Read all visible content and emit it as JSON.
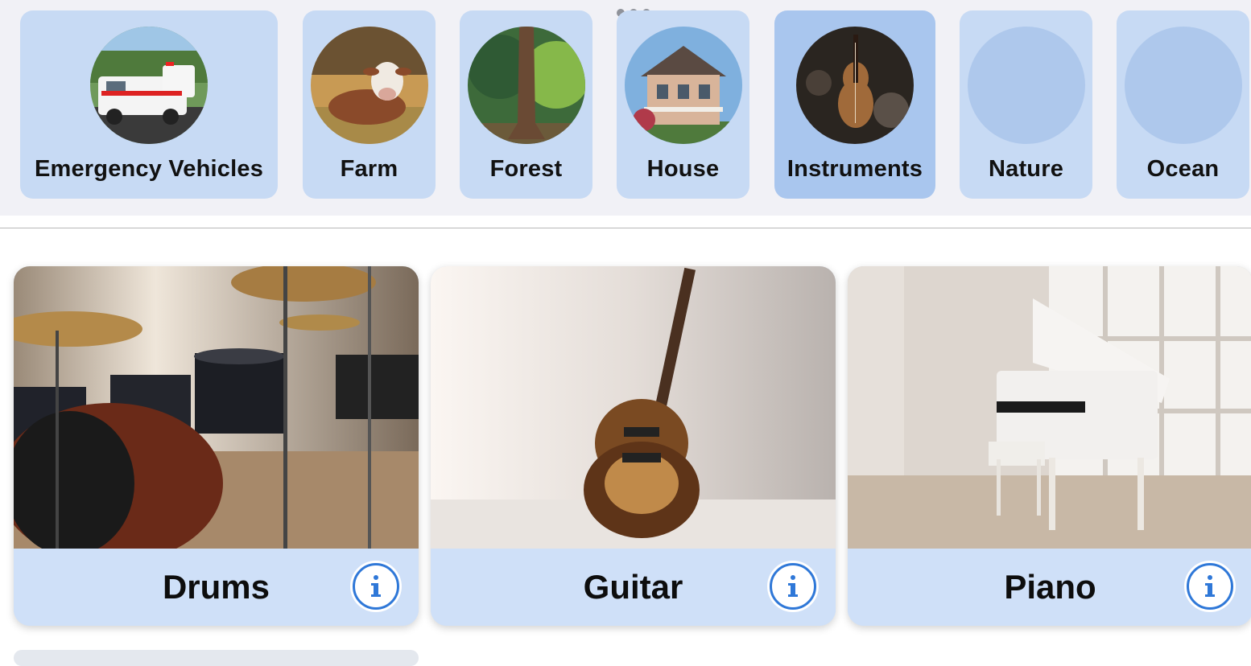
{
  "categories": [
    {
      "label": "Emergency Vehicles",
      "icon": "ambulance-thumbnail",
      "selected": false
    },
    {
      "label": "Farm",
      "icon": "cow-thumbnail",
      "selected": false
    },
    {
      "label": "Forest",
      "icon": "tree-thumbnail",
      "selected": false
    },
    {
      "label": "House",
      "icon": "house-thumbnail",
      "selected": false
    },
    {
      "label": "Instruments",
      "icon": "violin-thumbnail",
      "selected": true
    },
    {
      "label": "Nature",
      "icon": "placeholder-thumbnail",
      "selected": false
    },
    {
      "label": "Ocean",
      "icon": "placeholder-thumbnail",
      "selected": false
    }
  ],
  "cards": [
    {
      "title": "Drums",
      "photo": "drum-kit-photo",
      "info_icon": "info-icon"
    },
    {
      "title": "Guitar",
      "photo": "guitar-photo",
      "info_icon": "info-icon"
    },
    {
      "title": "Piano",
      "photo": "grand-piano-photo",
      "info_icon": "info-icon"
    }
  ],
  "colors": {
    "tile": "#c7daf4",
    "tile_selected": "#a9c6ee",
    "card_footer": "#cfe0f8",
    "accent": "#2f78d8"
  }
}
